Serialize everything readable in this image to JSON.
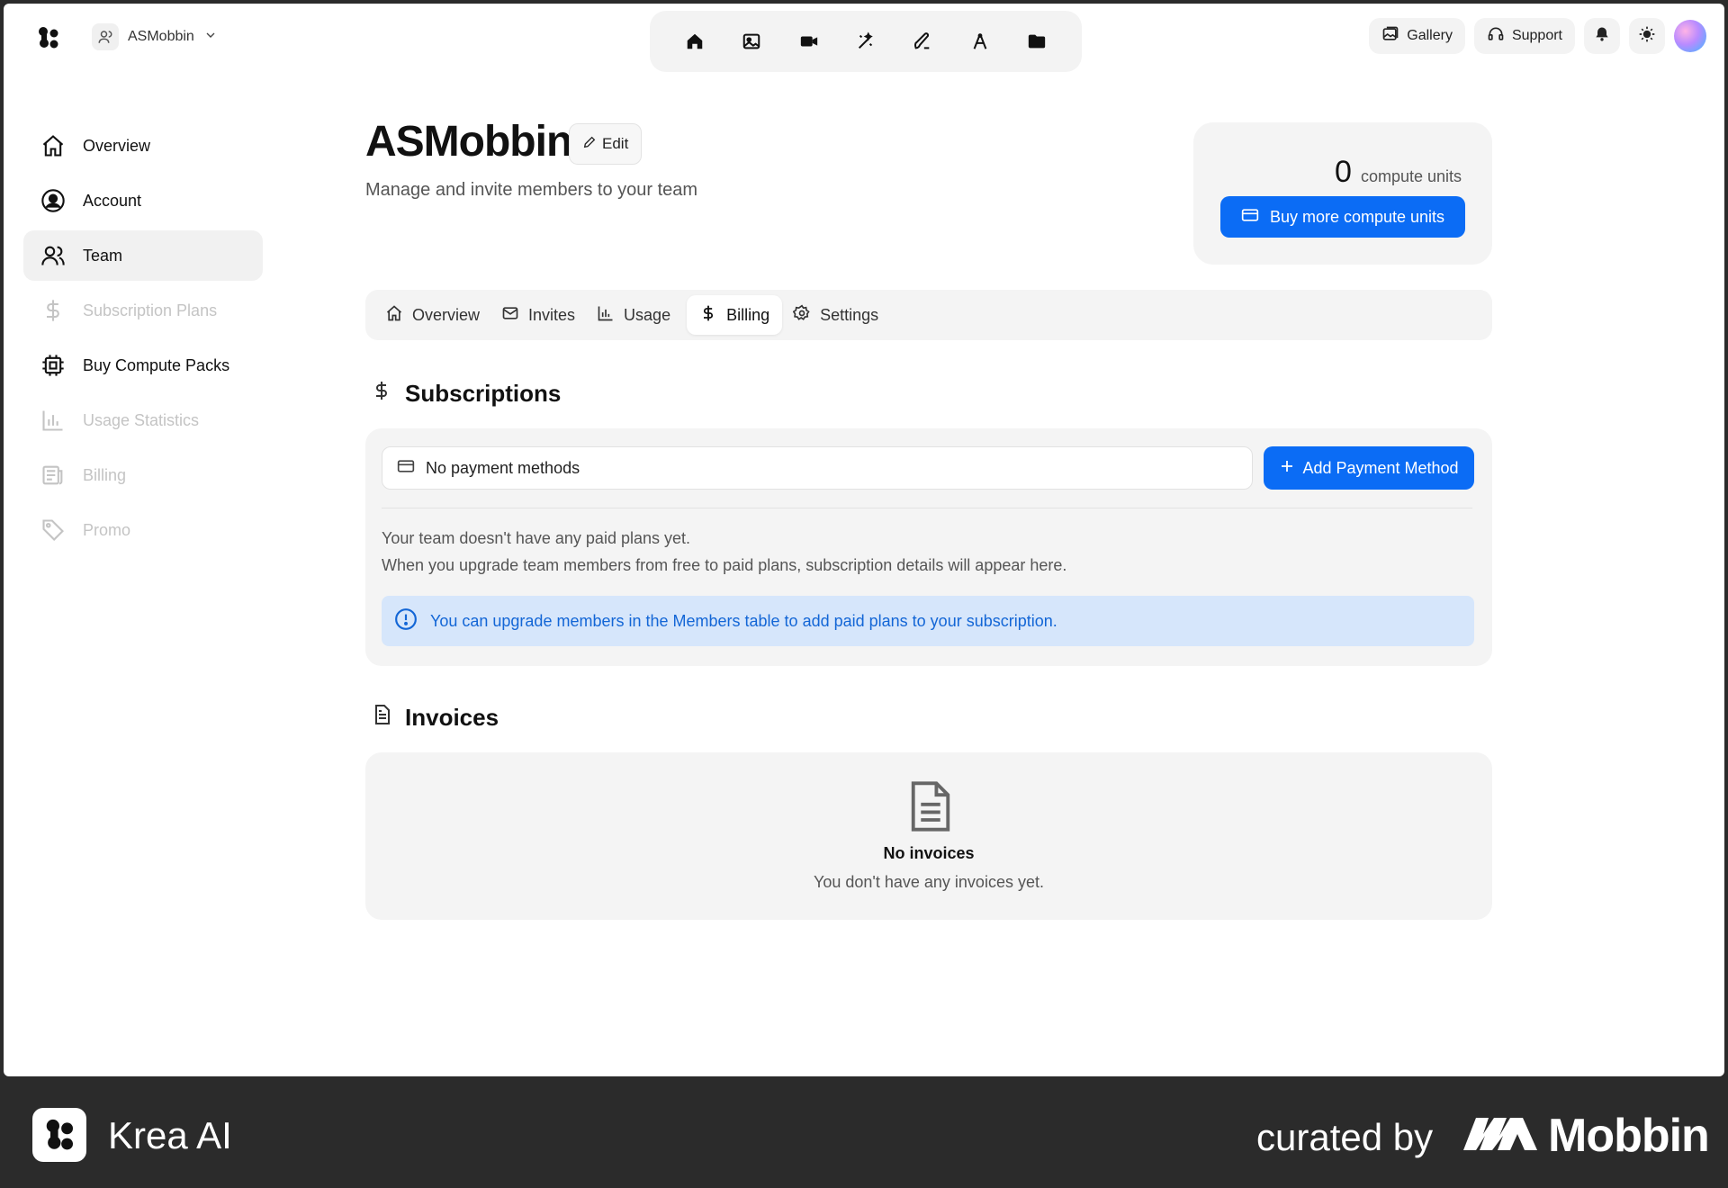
{
  "topbar": {
    "team_name": "ASMobbin",
    "tools": [
      "home",
      "image",
      "video",
      "enhance",
      "edit",
      "train",
      "assets"
    ],
    "gallery_label": "Gallery",
    "support_label": "Support"
  },
  "sidebar": {
    "items": [
      {
        "label": "Overview",
        "icon": "home-icon",
        "state": "normal"
      },
      {
        "label": "Account",
        "icon": "user-circle-icon",
        "state": "normal"
      },
      {
        "label": "Team",
        "icon": "users-icon",
        "state": "active"
      },
      {
        "label": "Subscription Plans",
        "icon": "dollar-icon",
        "state": "disabled"
      },
      {
        "label": "Buy Compute Packs",
        "icon": "chip-icon",
        "state": "normal"
      },
      {
        "label": "Usage Statistics",
        "icon": "bar-chart-icon",
        "state": "disabled"
      },
      {
        "label": "Billing",
        "icon": "receipt-icon",
        "state": "disabled"
      },
      {
        "label": "Promo",
        "icon": "tag-icon",
        "state": "disabled"
      }
    ]
  },
  "header": {
    "title": "ASMobbin",
    "edit_label": "Edit",
    "subtitle": "Manage and invite members to your team"
  },
  "credits": {
    "count": "0",
    "unit": "compute units",
    "buy_label": "Buy more compute units"
  },
  "tabs": [
    {
      "label": "Overview",
      "icon": "home-icon"
    },
    {
      "label": "Invites",
      "icon": "mail-icon"
    },
    {
      "label": "Usage",
      "icon": "bar-chart-icon"
    },
    {
      "label": "Billing",
      "icon": "dollar-icon",
      "active": true
    },
    {
      "label": "Settings",
      "icon": "gear-icon"
    }
  ],
  "subscriptions": {
    "title": "Subscriptions",
    "payment_placeholder": "No payment methods",
    "add_payment_label": "Add Payment Method",
    "line1": "Your team doesn't have any paid plans yet.",
    "line2": "When you upgrade team members from free to paid plans, subscription details will appear here.",
    "alert": "You can upgrade members in the Members table to add paid plans to your subscription."
  },
  "invoices": {
    "title": "Invoices",
    "empty_title": "No invoices",
    "empty_sub": "You don't have any invoices yet."
  },
  "footer": {
    "app_name": "Krea AI",
    "curated_by": "curated by",
    "brand": "Mobbin"
  },
  "colors": {
    "accent": "#0b6cf5",
    "alert_bg": "#d6e6fb",
    "alert_text": "#1366d6"
  }
}
